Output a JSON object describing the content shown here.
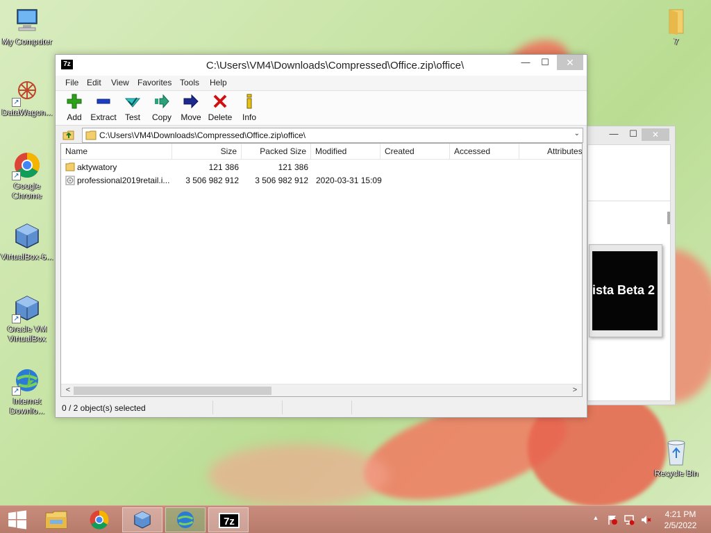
{
  "desktop": {
    "icons": [
      {
        "label": "My Computer"
      },
      {
        "label": "DataWagon..."
      },
      {
        "label": "Google Chrome"
      },
      {
        "label": "VirtualBox-6..."
      },
      {
        "label": "Oracle VM VirtualBox"
      },
      {
        "label": "Internet Downlo..."
      },
      {
        "label": "7"
      },
      {
        "label": "Recycle Bin"
      }
    ]
  },
  "background_window": {
    "close_label": "✕",
    "card_text": "ista Beta 2"
  },
  "window": {
    "app_icon_text": "7z",
    "title": "C:\\Users\\VM4\\Downloads\\Compressed\\Office.zip\\office\\",
    "minimize": "—",
    "maximize": "☐",
    "close": "✕",
    "menu": [
      "File",
      "Edit",
      "View",
      "Favorites",
      "Tools",
      "Help"
    ],
    "toolbar": [
      "Add",
      "Extract",
      "Test",
      "Copy",
      "Move",
      "Delete",
      "Info"
    ],
    "address": "C:\\Users\\VM4\\Downloads\\Compressed\\Office.zip\\office\\",
    "columns": [
      "Name",
      "Size",
      "Packed Size",
      "Modified",
      "Created",
      "Accessed",
      "Attributes"
    ],
    "rows": [
      {
        "name": "aktywatory",
        "size": "121 386",
        "packed": "121 386",
        "modified": ""
      },
      {
        "name": "professional2019retail.i...",
        "size": "3 506 982 912",
        "packed": "3 506 982 912",
        "modified": "2020-03-31 15:09"
      }
    ],
    "status": "0 / 2 object(s) selected"
  },
  "taskbar": {
    "clock_time": "4:21 PM",
    "clock_date": "2/5/2022",
    "tray_up": "▲",
    "sevenzip_label": "7z"
  },
  "colors": {
    "accent_close": "#c7c7c7",
    "taskbar": "#b77b6c",
    "add_green": "#2ea01c",
    "delete_red": "#d01010"
  }
}
